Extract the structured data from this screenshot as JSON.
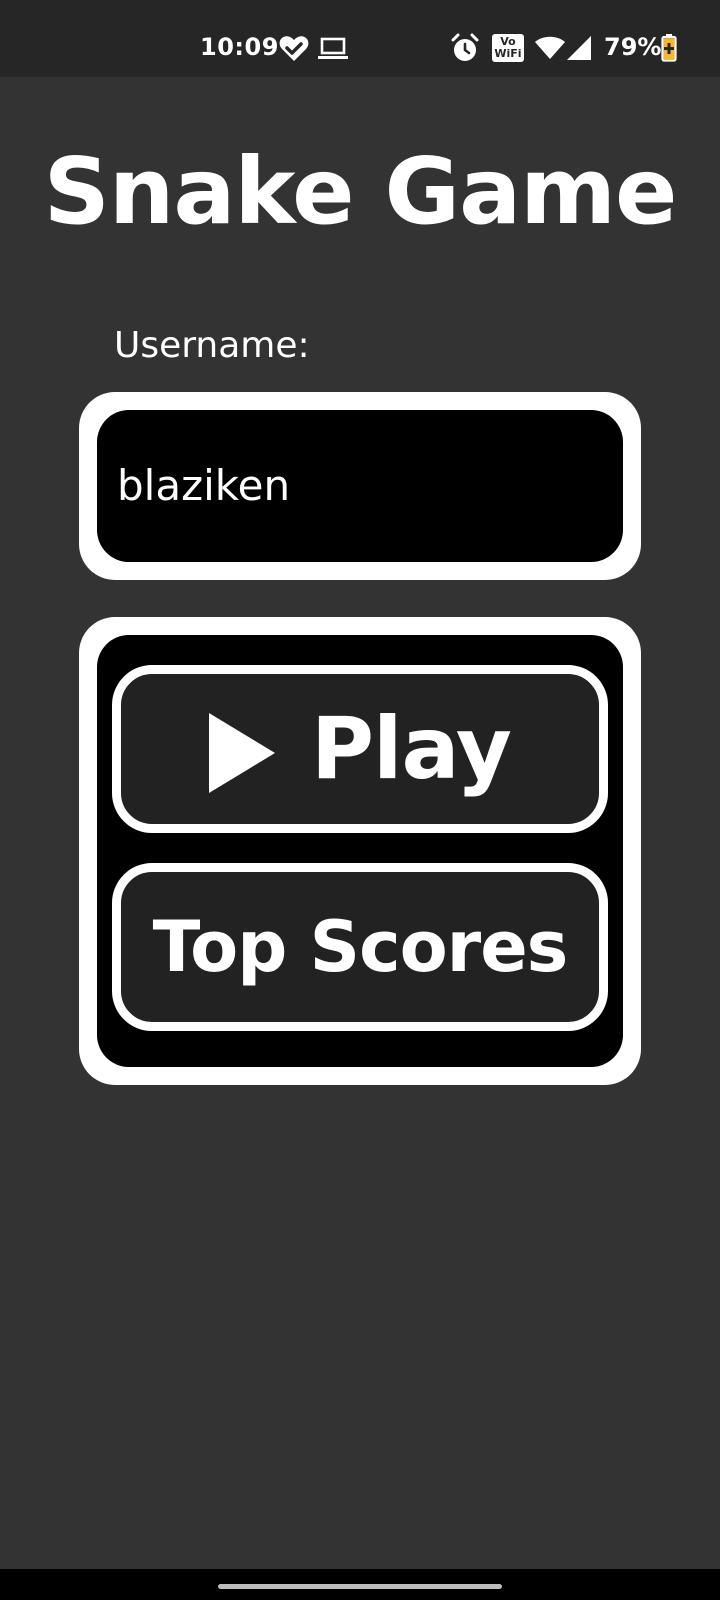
{
  "status_bar": {
    "time": "10:09",
    "battery_percent": "79%",
    "left_icons": [
      "heart-check-icon",
      "laptop-icon"
    ],
    "right_icons": [
      "alarm-icon",
      "vowifi-icon",
      "wifi-icon",
      "signal-icon",
      "battery-saver-icon"
    ],
    "vowifi_text_top": "Vo",
    "vowifi_text_bottom": "WiFi"
  },
  "title": "Snake Game",
  "username": {
    "label": "Username:",
    "value": "blaziken"
  },
  "menu": {
    "play_label": "Play",
    "play_icon": "play-triangle-icon",
    "top_scores_label": "Top Scores"
  },
  "colors": {
    "background": "#333333",
    "status_bar": "#262626",
    "panel_border": "#ffffff",
    "panel_fill": "#000000",
    "button_fill": "#222222",
    "text": "#ffffff"
  }
}
